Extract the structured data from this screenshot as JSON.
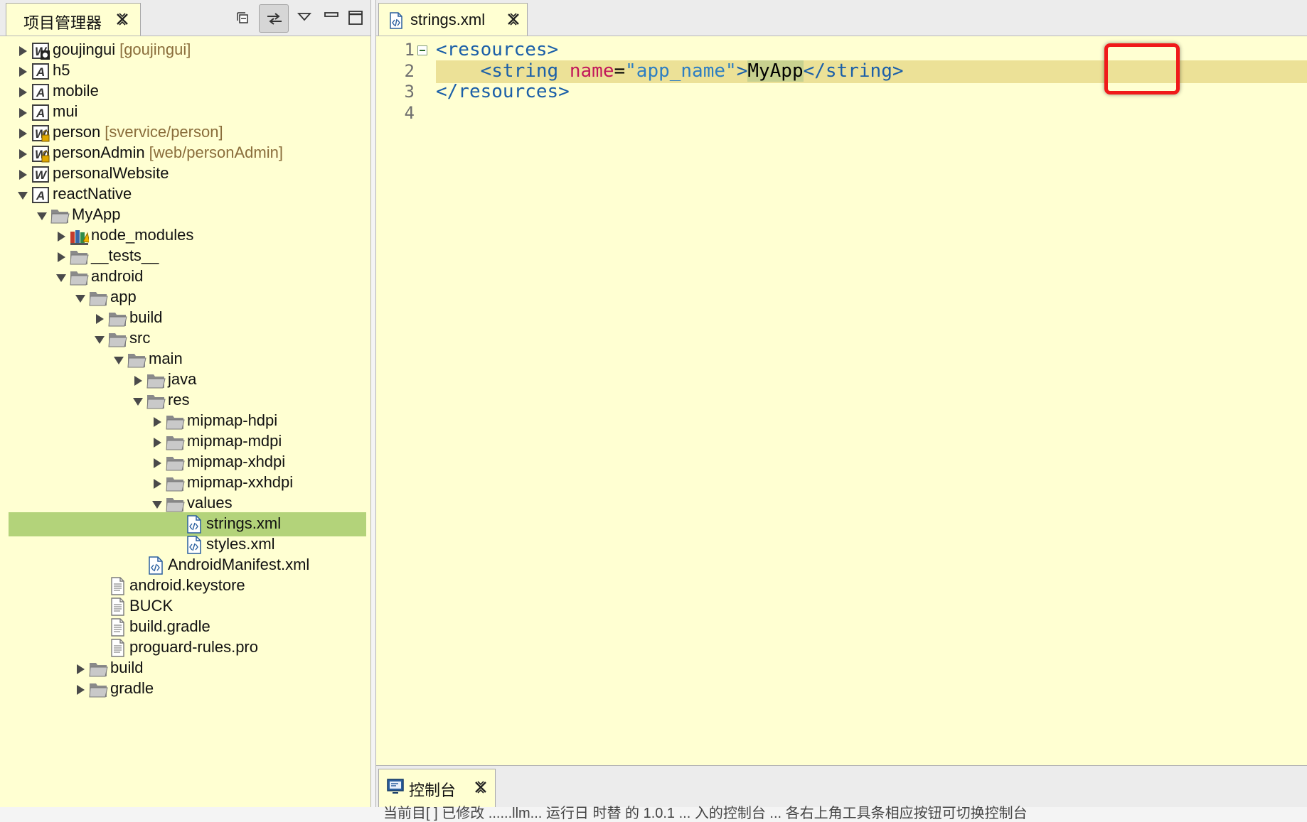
{
  "project_panel": {
    "title": "项目管理器",
    "tree": [
      {
        "label": "goujingui",
        "sub": "[goujingui]",
        "icon": "web-project-icon",
        "badge": "gear",
        "depth": 0,
        "expanded": false
      },
      {
        "label": "h5",
        "sub": "",
        "icon": "app-project-icon",
        "depth": 0,
        "expanded": false
      },
      {
        "label": "mobile",
        "sub": "",
        "icon": "app-project-icon",
        "depth": 0,
        "expanded": false
      },
      {
        "label": "mui",
        "sub": "",
        "icon": "app-project-icon",
        "depth": 0,
        "expanded": false
      },
      {
        "label": "person",
        "sub": "[svervice/person]",
        "icon": "web-project-icon",
        "badge": "lock",
        "depth": 0,
        "expanded": false
      },
      {
        "label": "personAdmin",
        "sub": "[web/personAdmin]",
        "icon": "web-project-icon",
        "badge": "lock",
        "depth": 0,
        "expanded": false
      },
      {
        "label": "personalWebsite",
        "sub": "",
        "icon": "web-project-icon",
        "depth": 0,
        "expanded": false
      },
      {
        "label": "reactNative",
        "sub": "",
        "icon": "app-project-icon",
        "depth": 0,
        "expanded": true
      },
      {
        "label": "MyApp",
        "sub": "",
        "icon": "folder-icon",
        "depth": 1,
        "expanded": true
      },
      {
        "label": "node_modules",
        "sub": "",
        "icon": "library-icon",
        "depth": 2,
        "expanded": false
      },
      {
        "label": "__tests__",
        "sub": "",
        "icon": "folder-icon",
        "depth": 2,
        "expanded": false
      },
      {
        "label": "android",
        "sub": "",
        "icon": "folder-icon",
        "depth": 2,
        "expanded": true
      },
      {
        "label": "app",
        "sub": "",
        "icon": "folder-icon",
        "depth": 3,
        "expanded": true
      },
      {
        "label": "build",
        "sub": "",
        "icon": "folder-icon",
        "depth": 4,
        "expanded": false
      },
      {
        "label": "src",
        "sub": "",
        "icon": "folder-icon",
        "depth": 4,
        "expanded": true
      },
      {
        "label": "main",
        "sub": "",
        "icon": "folder-icon",
        "depth": 5,
        "expanded": true
      },
      {
        "label": "java",
        "sub": "",
        "icon": "folder-icon",
        "depth": 6,
        "expanded": false
      },
      {
        "label": "res",
        "sub": "",
        "icon": "folder-icon",
        "depth": 6,
        "expanded": true
      },
      {
        "label": "mipmap-hdpi",
        "sub": "",
        "icon": "folder-icon",
        "depth": 7,
        "expanded": false
      },
      {
        "label": "mipmap-mdpi",
        "sub": "",
        "icon": "folder-icon",
        "depth": 7,
        "expanded": false
      },
      {
        "label": "mipmap-xhdpi",
        "sub": "",
        "icon": "folder-icon",
        "depth": 7,
        "expanded": false
      },
      {
        "label": "mipmap-xxhdpi",
        "sub": "",
        "icon": "folder-icon",
        "depth": 7,
        "expanded": false
      },
      {
        "label": "values",
        "sub": "",
        "icon": "folder-icon",
        "depth": 7,
        "expanded": true
      },
      {
        "label": "strings.xml",
        "sub": "",
        "icon": "xml-file-icon",
        "depth": 8,
        "selected": true
      },
      {
        "label": "styles.xml",
        "sub": "",
        "icon": "xml-file-icon",
        "depth": 8
      },
      {
        "label": "AndroidManifest.xml",
        "sub": "",
        "icon": "xml-file-icon",
        "depth": 6
      },
      {
        "label": "android.keystore",
        "sub": "",
        "icon": "text-file-icon",
        "depth": 4
      },
      {
        "label": "BUCK",
        "sub": "",
        "icon": "text-file-icon",
        "depth": 4
      },
      {
        "label": "build.gradle",
        "sub": "",
        "icon": "text-file-icon",
        "depth": 4
      },
      {
        "label": "proguard-rules.pro",
        "sub": "",
        "icon": "text-file-icon",
        "depth": 4
      },
      {
        "label": "build",
        "sub": "",
        "icon": "folder-icon",
        "depth": 3,
        "expanded": false
      },
      {
        "label": "gradle",
        "sub": "",
        "icon": "folder-icon",
        "depth": 3,
        "expanded": false
      }
    ]
  },
  "editor": {
    "tab_label": "strings.xml",
    "lines": [
      {
        "num": "1",
        "fold": true,
        "tokens": [
          {
            "t": "tag",
            "v": "<resources>"
          }
        ]
      },
      {
        "num": "2",
        "current": true,
        "tokens": [
          {
            "t": "plain",
            "v": "    "
          },
          {
            "t": "tag",
            "v": "<string "
          },
          {
            "t": "attr",
            "v": "name"
          },
          {
            "t": "plain",
            "v": "="
          },
          {
            "t": "val",
            "v": "\"app_name\""
          },
          {
            "t": "tag",
            "v": ">"
          },
          {
            "t": "txt",
            "v": "MyApp"
          },
          {
            "t": "tag",
            "v": "</string>"
          }
        ]
      },
      {
        "num": "3",
        "tokens": [
          {
            "t": "tag",
            "v": "</resources>"
          }
        ]
      },
      {
        "num": "4",
        "tokens": []
      }
    ]
  },
  "console": {
    "tab_label": "控制台",
    "text": "当前目[  ] 已修改 ......llm... 运行日 时替 的 1.0.1 ... 入的控制台 ... 各右上角工具条相应按钮可切换控制台"
  },
  "colors": {
    "panel_bg": "#ffffd2",
    "selection": "#b3d37a",
    "current_line": "#ece197",
    "highlight_box": "#f01a1a"
  }
}
